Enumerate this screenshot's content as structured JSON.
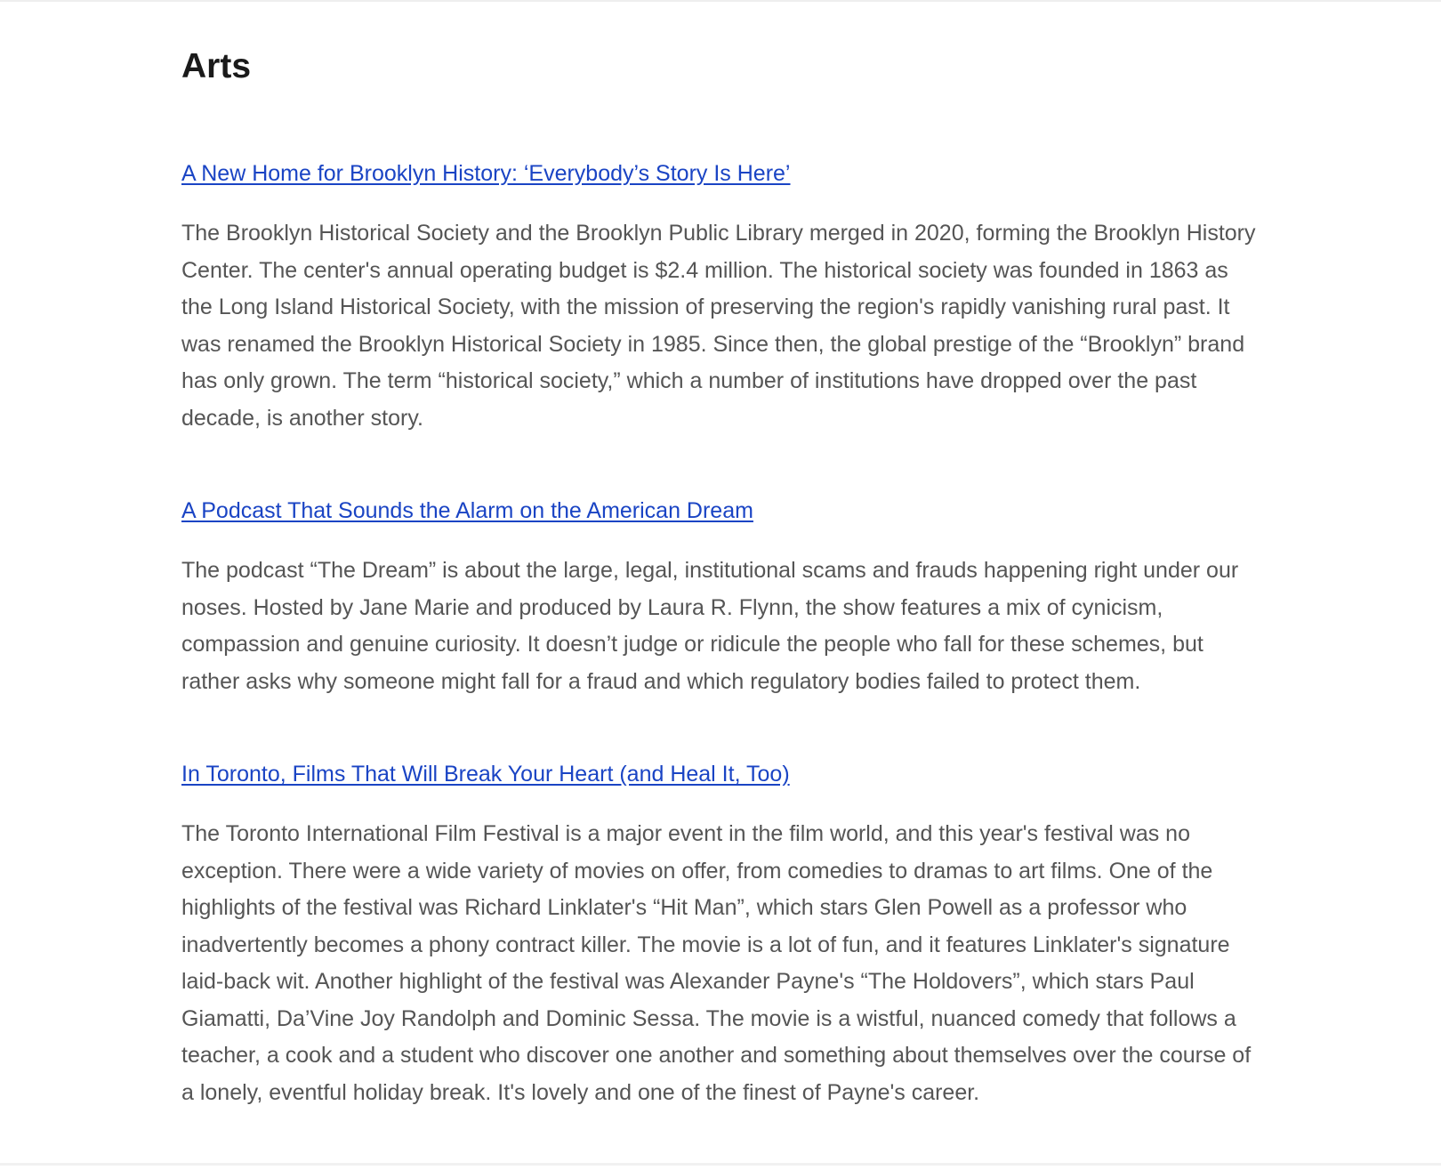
{
  "section": {
    "title": "Arts"
  },
  "articles": [
    {
      "title": "A New Home for Brooklyn History: ‘Everybody’s Story Is Here’",
      "body": "The Brooklyn Historical Society and the Brooklyn Public Library merged in 2020, forming the Brooklyn History Center. The center's annual operating budget is $2.4 million. The historical society was founded in 1863 as the Long Island Historical Society, with the mission of preserving the region's rapidly vanishing rural past. It was renamed the Brooklyn Historical Society in 1985. Since then, the global prestige of the “Brooklyn” brand has only grown. The term “historical society,” which a number of institutions have dropped over the past decade, is another story."
    },
    {
      "title": "A Podcast That Sounds the Alarm on the American Dream",
      "body": "The podcast “The Dream” is about the large, legal, institutional scams and frauds happening right under our noses. Hosted by Jane Marie and produced by Laura R. Flynn, the show features a mix of cynicism, compassion and genuine curiosity. It doesn’t judge or ridicule the people who fall for these schemes, but rather asks why someone might fall for a fraud and which regulatory bodies failed to protect them."
    },
    {
      "title": "In Toronto, Films That Will Break Your Heart (and Heal It, Too)",
      "body": "The Toronto International Film Festival is a major event in the film world, and this year's festival was no exception. There were a wide variety of movies on offer, from comedies to dramas to art films. One of the highlights of the festival was Richard Linklater's “Hit Man”, which stars Glen Powell as a professor who inadvertently becomes a phony contract killer. The movie is a lot of fun, and it features Linklater's signature laid-back wit. Another highlight of the festival was Alexander Payne's “The Holdovers”, which stars Paul Giamatti, Da’Vine Joy Randolph and Dominic Sessa. The movie is a wistful, nuanced comedy that follows a teacher, a cook and a student who discover one another and something about themselves over the course of a lonely, eventful holiday break. It's lovely and one of the finest of Payne's career."
    }
  ]
}
